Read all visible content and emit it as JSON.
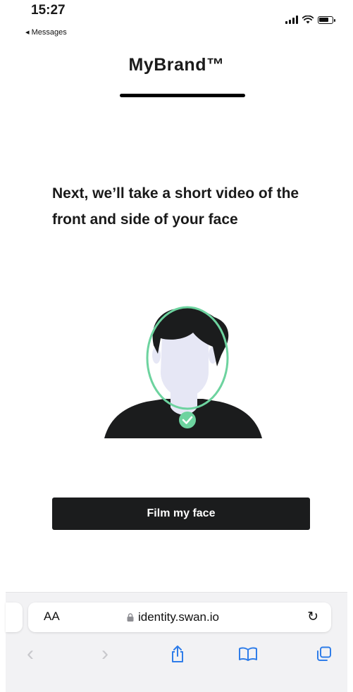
{
  "status_bar": {
    "time": "15:27",
    "back_label": "◂ Messages",
    "battery_level": 0.75
  },
  "header": {
    "brand": "MyBrand™"
  },
  "main": {
    "heading": "Next, we’ll take a short video of the front and side of your face",
    "cta_label": "Film my face"
  },
  "browser": {
    "text_size_label": "AA",
    "url": "identity.swan.io",
    "icons": [
      "lock-icon",
      "reload-icon",
      "back-icon",
      "forward-icon",
      "share-icon",
      "bookmarks-icon",
      "tabs-icon"
    ]
  },
  "colors": {
    "accent_green": "#6dd39f",
    "face": "#e6e7f5",
    "dark": "#1b1c1d",
    "ios_blue": "#2f7de9"
  }
}
